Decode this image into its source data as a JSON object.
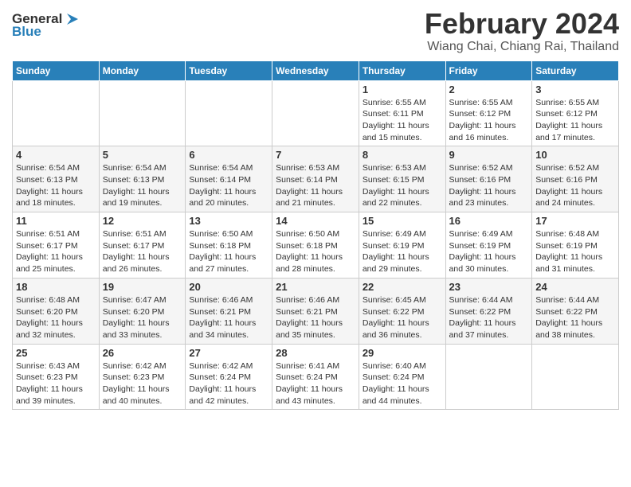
{
  "header": {
    "logo_line1": "General",
    "logo_line2": "Blue",
    "main_title": "February 2024",
    "subtitle": "Wiang Chai, Chiang Rai, Thailand"
  },
  "calendar": {
    "days_of_week": [
      "Sunday",
      "Monday",
      "Tuesday",
      "Wednesday",
      "Thursday",
      "Friday",
      "Saturday"
    ],
    "weeks": [
      [
        {
          "day": "",
          "info": ""
        },
        {
          "day": "",
          "info": ""
        },
        {
          "day": "",
          "info": ""
        },
        {
          "day": "",
          "info": ""
        },
        {
          "day": "1",
          "info": "Sunrise: 6:55 AM\nSunset: 6:11 PM\nDaylight: 11 hours\nand 15 minutes."
        },
        {
          "day": "2",
          "info": "Sunrise: 6:55 AM\nSunset: 6:12 PM\nDaylight: 11 hours\nand 16 minutes."
        },
        {
          "day": "3",
          "info": "Sunrise: 6:55 AM\nSunset: 6:12 PM\nDaylight: 11 hours\nand 17 minutes."
        }
      ],
      [
        {
          "day": "4",
          "info": "Sunrise: 6:54 AM\nSunset: 6:13 PM\nDaylight: 11 hours\nand 18 minutes."
        },
        {
          "day": "5",
          "info": "Sunrise: 6:54 AM\nSunset: 6:13 PM\nDaylight: 11 hours\nand 19 minutes."
        },
        {
          "day": "6",
          "info": "Sunrise: 6:54 AM\nSunset: 6:14 PM\nDaylight: 11 hours\nand 20 minutes."
        },
        {
          "day": "7",
          "info": "Sunrise: 6:53 AM\nSunset: 6:14 PM\nDaylight: 11 hours\nand 21 minutes."
        },
        {
          "day": "8",
          "info": "Sunrise: 6:53 AM\nSunset: 6:15 PM\nDaylight: 11 hours\nand 22 minutes."
        },
        {
          "day": "9",
          "info": "Sunrise: 6:52 AM\nSunset: 6:16 PM\nDaylight: 11 hours\nand 23 minutes."
        },
        {
          "day": "10",
          "info": "Sunrise: 6:52 AM\nSunset: 6:16 PM\nDaylight: 11 hours\nand 24 minutes."
        }
      ],
      [
        {
          "day": "11",
          "info": "Sunrise: 6:51 AM\nSunset: 6:17 PM\nDaylight: 11 hours\nand 25 minutes."
        },
        {
          "day": "12",
          "info": "Sunrise: 6:51 AM\nSunset: 6:17 PM\nDaylight: 11 hours\nand 26 minutes."
        },
        {
          "day": "13",
          "info": "Sunrise: 6:50 AM\nSunset: 6:18 PM\nDaylight: 11 hours\nand 27 minutes."
        },
        {
          "day": "14",
          "info": "Sunrise: 6:50 AM\nSunset: 6:18 PM\nDaylight: 11 hours\nand 28 minutes."
        },
        {
          "day": "15",
          "info": "Sunrise: 6:49 AM\nSunset: 6:19 PM\nDaylight: 11 hours\nand 29 minutes."
        },
        {
          "day": "16",
          "info": "Sunrise: 6:49 AM\nSunset: 6:19 PM\nDaylight: 11 hours\nand 30 minutes."
        },
        {
          "day": "17",
          "info": "Sunrise: 6:48 AM\nSunset: 6:19 PM\nDaylight: 11 hours\nand 31 minutes."
        }
      ],
      [
        {
          "day": "18",
          "info": "Sunrise: 6:48 AM\nSunset: 6:20 PM\nDaylight: 11 hours\nand 32 minutes."
        },
        {
          "day": "19",
          "info": "Sunrise: 6:47 AM\nSunset: 6:20 PM\nDaylight: 11 hours\nand 33 minutes."
        },
        {
          "day": "20",
          "info": "Sunrise: 6:46 AM\nSunset: 6:21 PM\nDaylight: 11 hours\nand 34 minutes."
        },
        {
          "day": "21",
          "info": "Sunrise: 6:46 AM\nSunset: 6:21 PM\nDaylight: 11 hours\nand 35 minutes."
        },
        {
          "day": "22",
          "info": "Sunrise: 6:45 AM\nSunset: 6:22 PM\nDaylight: 11 hours\nand 36 minutes."
        },
        {
          "day": "23",
          "info": "Sunrise: 6:44 AM\nSunset: 6:22 PM\nDaylight: 11 hours\nand 37 minutes."
        },
        {
          "day": "24",
          "info": "Sunrise: 6:44 AM\nSunset: 6:22 PM\nDaylight: 11 hours\nand 38 minutes."
        }
      ],
      [
        {
          "day": "25",
          "info": "Sunrise: 6:43 AM\nSunset: 6:23 PM\nDaylight: 11 hours\nand 39 minutes."
        },
        {
          "day": "26",
          "info": "Sunrise: 6:42 AM\nSunset: 6:23 PM\nDaylight: 11 hours\nand 40 minutes."
        },
        {
          "day": "27",
          "info": "Sunrise: 6:42 AM\nSunset: 6:24 PM\nDaylight: 11 hours\nand 42 minutes."
        },
        {
          "day": "28",
          "info": "Sunrise: 6:41 AM\nSunset: 6:24 PM\nDaylight: 11 hours\nand 43 minutes."
        },
        {
          "day": "29",
          "info": "Sunrise: 6:40 AM\nSunset: 6:24 PM\nDaylight: 11 hours\nand 44 minutes."
        },
        {
          "day": "",
          "info": ""
        },
        {
          "day": "",
          "info": ""
        }
      ]
    ]
  }
}
